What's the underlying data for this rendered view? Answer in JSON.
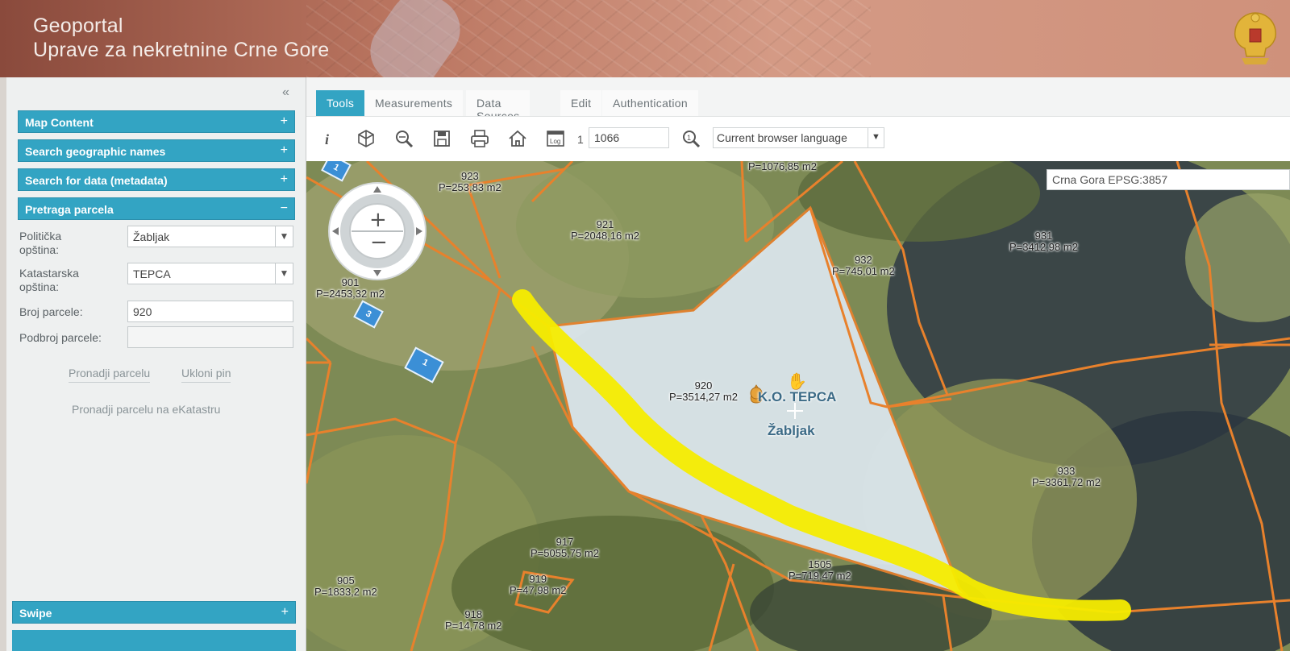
{
  "header": {
    "title_line1": "Geoportal",
    "title_line2": "Uprave za nekretnine Crne Gore"
  },
  "sidebar": {
    "sections": [
      {
        "label": "Map Content",
        "sign": "+"
      },
      {
        "label": "Search geographic names",
        "sign": "+"
      },
      {
        "label": "Search for data (metadata)",
        "sign": "+"
      },
      {
        "label": "Pretraga parcela",
        "sign": "−"
      }
    ],
    "form": {
      "municipality_label_1": "Politička",
      "municipality_label_2": "opština:",
      "municipality_value": "Žabljak",
      "cadastral_label_1": "Katastarska",
      "cadastral_label_2": "opština:",
      "cadastral_value": "TEPCA",
      "parcel_number_label": "Broj parcele:",
      "parcel_number_value": "920",
      "sub_number_label": "Podbroj parcele:",
      "sub_number_value": "",
      "find_button": "Pronadji parcelu",
      "remove_pin_button": "Ukloni pin",
      "find_ekatastar_link": "Pronadji parcelu na eKatastru"
    },
    "bottom_section": {
      "label": "Swipe",
      "sign": "+"
    }
  },
  "tabs": [
    "Tools",
    "Measurements",
    "Data Sources",
    "Edit",
    "Authentication"
  ],
  "toolbar": {
    "scale_prefix": "1",
    "scale_value": "1066",
    "language_value": "Current browser language",
    "tools": [
      "info-icon",
      "3d-icon",
      "zoom-search-icon",
      "save-icon",
      "print-icon",
      "home-icon",
      "log-icon",
      "scale-search-icon"
    ]
  },
  "map": {
    "crs_label": "Crna Gora EPSG:3857",
    "place_line1": "K.O. TEPCA",
    "place_line2": "Žabljak",
    "parcels": [
      {
        "num": "",
        "area": "P=1076,85 m2"
      },
      {
        "num": "923",
        "area": "P=253,83 m2"
      },
      {
        "num": "921",
        "area": "P=2048,16 m2"
      },
      {
        "num": "931",
        "area": "P=3412,98 m2"
      },
      {
        "num": "932",
        "area": "P=745,01 m2"
      },
      {
        "num": "901",
        "area": "P=2453,32 m2"
      },
      {
        "num": "920",
        "area": "P=3514,27 m2"
      },
      {
        "num": "933",
        "area": "P=3361,72 m2"
      },
      {
        "num": "917",
        "area": "P=5055,75 m2"
      },
      {
        "num": "1505",
        "area": "P=719,47 m2"
      },
      {
        "num": "919",
        "area": "P=47,98 m2"
      },
      {
        "num": "905",
        "area": "P=1833,2 m2"
      },
      {
        "num": "918",
        "area": "P=14,78 m2"
      }
    ],
    "pins": [
      "1",
      "3",
      "1"
    ],
    "colors": {
      "boundary": "#e8812c",
      "highlight": "#f5ec00",
      "selected_fill": "#dce8f1",
      "accent": "#33a4c3"
    }
  }
}
